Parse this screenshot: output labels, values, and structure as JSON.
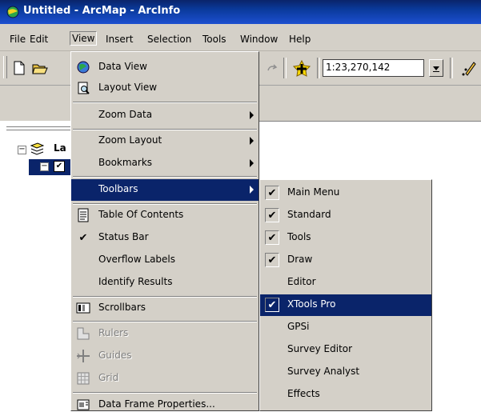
{
  "window": {
    "title": "Untitled - ArcMap - ArcInfo"
  },
  "menubar": {
    "items": [
      {
        "label": "File"
      },
      {
        "label": "Edit"
      },
      {
        "label": "View"
      },
      {
        "label": "Insert"
      },
      {
        "label": "Selection"
      },
      {
        "label": "Tools"
      },
      {
        "label": "Window"
      },
      {
        "label": "Help"
      }
    ]
  },
  "toolbar": {
    "scale_value": "1:23,270,142"
  },
  "toc": {
    "layer_label": "La"
  },
  "view_menu": {
    "items": [
      {
        "label": "Data View",
        "icon": "globe-icon"
      },
      {
        "label": "Layout View",
        "icon": "page-magnifier-icon"
      },
      {
        "label": "Zoom Data"
      },
      {
        "label": "Zoom Layout"
      },
      {
        "label": "Bookmarks"
      },
      {
        "label": "Toolbars"
      },
      {
        "label": "Table Of Contents",
        "icon": "table-of-contents-icon"
      },
      {
        "label": "Status Bar",
        "checked": true
      },
      {
        "label": "Overflow Labels"
      },
      {
        "label": "Identify Results"
      },
      {
        "label": "Scrollbars",
        "icon": "scrollbars-icon"
      },
      {
        "label": "Rulers",
        "icon": "rulers-icon",
        "disabled": true
      },
      {
        "label": "Guides",
        "icon": "guides-icon",
        "disabled": true
      },
      {
        "label": "Grid",
        "icon": "grid-icon",
        "disabled": true
      },
      {
        "label": "Data Frame Properties...",
        "icon": "data-frame-properties-icon"
      }
    ]
  },
  "toolbars_submenu": {
    "items": [
      {
        "label": "Main Menu",
        "checked": true
      },
      {
        "label": "Standard",
        "checked": true
      },
      {
        "label": "Tools",
        "checked": true
      },
      {
        "label": "Draw",
        "checked": true
      },
      {
        "label": "Editor",
        "checked": false
      },
      {
        "label": "XTools Pro",
        "checked": true
      },
      {
        "label": "GPSi",
        "checked": false
      },
      {
        "label": "Survey Editor",
        "checked": false
      },
      {
        "label": "Survey Analyst",
        "checked": false
      },
      {
        "label": "Effects",
        "checked": false
      }
    ]
  },
  "icons": {
    "check": "✔",
    "expand_minus": "−"
  },
  "colors": {
    "title_bar": "#0a246a",
    "highlight": "#0a246a",
    "face": "#d4d0c8"
  }
}
